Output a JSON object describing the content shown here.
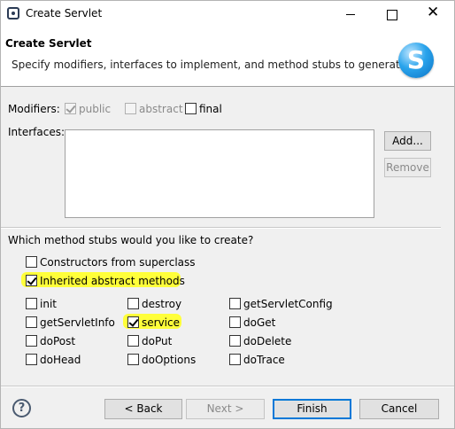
{
  "window": {
    "title": "Create Servlet"
  },
  "banner": {
    "title": "Create Servlet",
    "description": "Specify modifiers, interfaces to implement, and method stubs to generate.",
    "logo_letter": "S"
  },
  "modifiers": {
    "label": "Modifiers:",
    "public": {
      "label": "public",
      "checked": true,
      "enabled": false
    },
    "abstract": {
      "label": "abstract",
      "checked": false,
      "enabled": false
    },
    "final": {
      "label": "final",
      "checked": false,
      "enabled": true
    }
  },
  "interfaces": {
    "label": "Interfaces:",
    "add_button": "Add...",
    "remove_button": "Remove"
  },
  "stubs": {
    "question": "Which method stubs would you like to create?",
    "constructors": {
      "label": "Constructors from superclass",
      "checked": false
    },
    "inherited": {
      "label": "Inherited abstract methods",
      "checked": true
    },
    "methods": [
      {
        "label": "init",
        "checked": false
      },
      {
        "label": "destroy",
        "checked": false
      },
      {
        "label": "getServletConfig",
        "checked": false
      },
      {
        "label": "getServletInfo",
        "checked": false
      },
      {
        "label": "service",
        "checked": true
      },
      {
        "label": "doGet",
        "checked": false
      },
      {
        "label": "doPost",
        "checked": false
      },
      {
        "label": "doPut",
        "checked": false
      },
      {
        "label": "doDelete",
        "checked": false
      },
      {
        "label": "doHead",
        "checked": false
      },
      {
        "label": "doOptions",
        "checked": false
      },
      {
        "label": "doTrace",
        "checked": false
      }
    ]
  },
  "footer": {
    "help_icon": "?",
    "back_button": "< Back",
    "next_button": "Next >",
    "finish_button": "Finish",
    "cancel_button": "Cancel"
  },
  "colors": {
    "highlight": "#ffff3a",
    "default_button_border": "#0078d7"
  }
}
